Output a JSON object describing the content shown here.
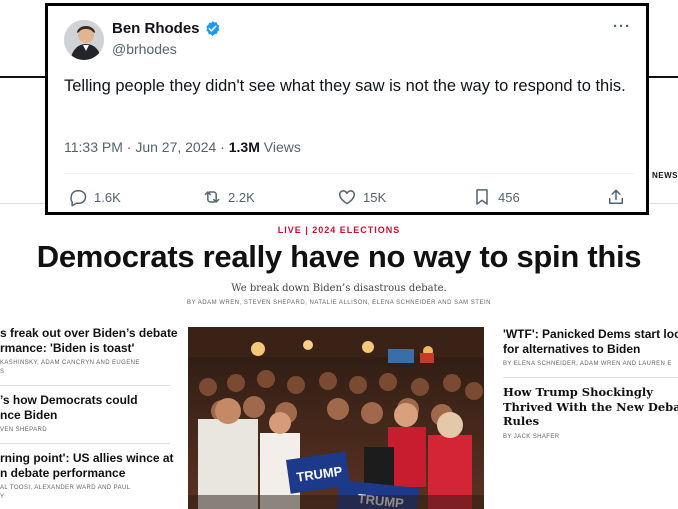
{
  "tweet": {
    "name": "Ben Rhodes",
    "handle": "@brhodes",
    "text": "Telling people they didn't see what they saw is not the way to respond to this.",
    "time": "11:33 PM · Jun 27, 2024 · ",
    "views_count": "1.3M",
    "views_label": " Views",
    "replies": "1.6K",
    "reposts": "2.2K",
    "likes": "15K",
    "bookmarks": "456"
  },
  "news": {
    "side_label": "NEWS",
    "kicker": "LIVE | 2024 ELECTIONS",
    "headline": "Democrats really have no way to spin this",
    "dek": "We break down Biden’s disastrous debate.",
    "byline": "BY ADAM WREN, STEVEN SHEPARD, NATALIE ALLISON, ELENA SCHNEIDER AND SAM STEIN",
    "left_stories": [
      {
        "h1": "s freak out over Biden’s debate",
        "h2": "rmance: 'Biden is toast'",
        "by1": "KASHINSKY, ADAM CANCRYN AND EUGENE",
        "by2": "S"
      },
      {
        "h1": "’s how Democrats could",
        "h2": "nce Biden",
        "by1": "VEN SHEPARD",
        "by2": ""
      },
      {
        "h1": "rning point': US allies wince at",
        "h2": "n debate performance",
        "by1": "AL TOOSI, ALEXANDER WARD AND PAUL",
        "by2": "Y"
      }
    ],
    "right_stories": [
      {
        "h1": "'WTF': Panicked Dems start look",
        "h2": "for alternatives to Biden",
        "h3": "",
        "by": "BY ELENA SCHNEIDER, ADAM WREN AND LAUREN E"
      },
      {
        "h1": "How Trump Shockingly",
        "h2": "Thrived With the New Deba",
        "h3": "Rules",
        "by": "BY JACK SHAFER"
      }
    ],
    "sign1": "TRUMP",
    "sign2": "TRUMP"
  },
  "colors": {
    "verified": "#1d9bf0",
    "kicker": "#c8102e",
    "muted": "#536471"
  }
}
